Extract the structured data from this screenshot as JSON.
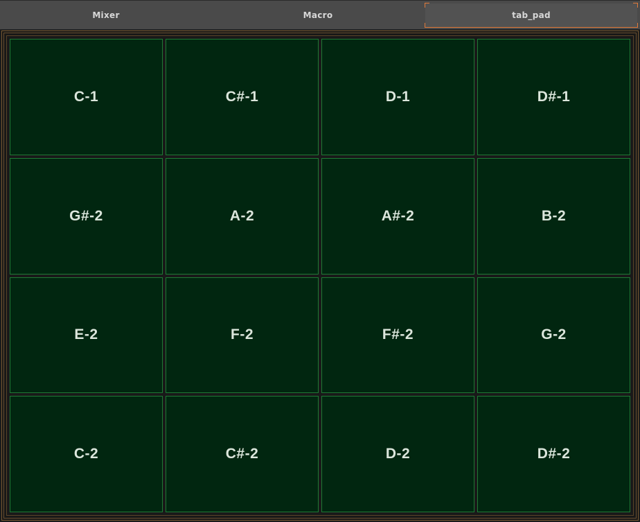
{
  "tabs": [
    {
      "label": "Mixer",
      "active": false
    },
    {
      "label": "Macro",
      "active": false
    },
    {
      "label": "tab_pad",
      "active": true
    }
  ],
  "colors": {
    "tabbar_bg": "#4a4a4a",
    "active_tab_accent": "#e07a3a",
    "pad_bg": "#012610",
    "pad_border": "#1f7a35",
    "pad_text": "#dce6dc"
  },
  "pads": {
    "rows": [
      [
        "C-1",
        "C#-1",
        "D-1",
        "D#-1"
      ],
      [
        "G#-2",
        "A-2",
        "A#-2",
        "B-2"
      ],
      [
        "E-2",
        "F-2",
        "F#-2",
        "G-2"
      ],
      [
        "C-2",
        "C#-2",
        "D-2",
        "D#-2"
      ]
    ]
  }
}
